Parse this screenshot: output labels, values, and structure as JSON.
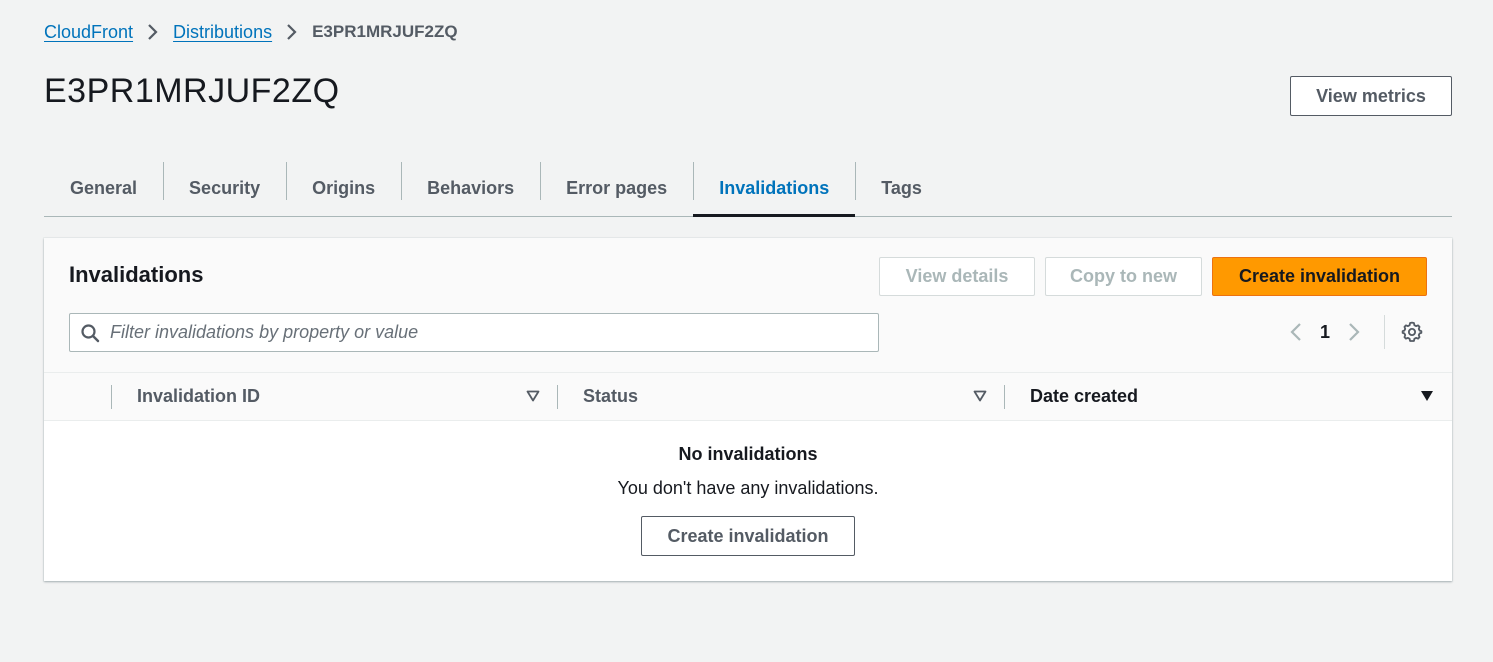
{
  "breadcrumb": {
    "items": [
      "CloudFront",
      "Distributions"
    ],
    "current": "E3PR1MRJUF2ZQ"
  },
  "header": {
    "title": "E3PR1MRJUF2ZQ",
    "view_metrics_label": "View metrics"
  },
  "tabs": [
    {
      "label": "General",
      "active": false
    },
    {
      "label": "Security",
      "active": false
    },
    {
      "label": "Origins",
      "active": false
    },
    {
      "label": "Behaviors",
      "active": false
    },
    {
      "label": "Error pages",
      "active": false
    },
    {
      "label": "Invalidations",
      "active": true
    },
    {
      "label": "Tags",
      "active": false
    }
  ],
  "invalidations": {
    "title": "Invalidations",
    "view_details_label": "View details",
    "copy_to_new_label": "Copy to new",
    "create_label": "Create invalidation",
    "filter": {
      "placeholder": "Filter invalidations by property or value",
      "value": ""
    },
    "pagination": {
      "current_page": "1"
    },
    "columns": [
      {
        "label": "Invalidation ID",
        "sort": "none"
      },
      {
        "label": "Status",
        "sort": "none"
      },
      {
        "label": "Date created",
        "sort": "descending"
      }
    ],
    "empty": {
      "title": "No invalidations",
      "description": "You don't have any invalidations.",
      "button_label": "Create invalidation"
    }
  },
  "colors": {
    "primary_button": "#ff9900",
    "link": "#0073bb",
    "active_tab_underline": "#16191f",
    "background": "#f2f3f3"
  },
  "icons": {
    "breadcrumb_separator": "chevron-right-icon",
    "search": "search-icon",
    "pagination_prev": "chevron-left-icon",
    "pagination_next": "chevron-right-icon",
    "settings": "gear-icon",
    "sort": "caret-down-icon"
  }
}
